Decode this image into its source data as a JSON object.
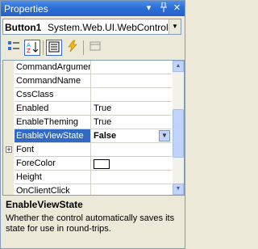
{
  "window": {
    "title": "Properties"
  },
  "object_selector": {
    "name": "Button1",
    "type": "System.Web.UI.WebControls.Bu"
  },
  "toolbar": {
    "items": [
      {
        "icon": "categorized-icon",
        "active": false
      },
      {
        "icon": "alphabetical-icon",
        "active": true
      },
      {
        "icon": "properties-icon",
        "active": true
      },
      {
        "icon": "events-icon",
        "active": false
      },
      {
        "icon": "property-pages-icon",
        "active": false
      }
    ]
  },
  "grid": {
    "rows": [
      {
        "name": "CommandArgumen",
        "value": ""
      },
      {
        "name": "CommandName",
        "value": ""
      },
      {
        "name": "CssClass",
        "value": ""
      },
      {
        "name": "Enabled",
        "value": "True"
      },
      {
        "name": "EnableTheming",
        "value": "True"
      },
      {
        "name": "EnableViewState",
        "value": "False",
        "selected": true
      },
      {
        "name": "Font",
        "value": "",
        "expandable": true
      },
      {
        "name": "ForeColor",
        "value": ""
      },
      {
        "name": "Height",
        "value": ""
      },
      {
        "name": "OnClientClick",
        "value": ""
      }
    ]
  },
  "description": {
    "title": "EnableViewState",
    "text": "Whether the control automatically saves its state for use in round-trips."
  },
  "colors": {
    "titlebar": "#2E6FD8",
    "selection": "#316AC5",
    "background": "#ECE9D8"
  }
}
